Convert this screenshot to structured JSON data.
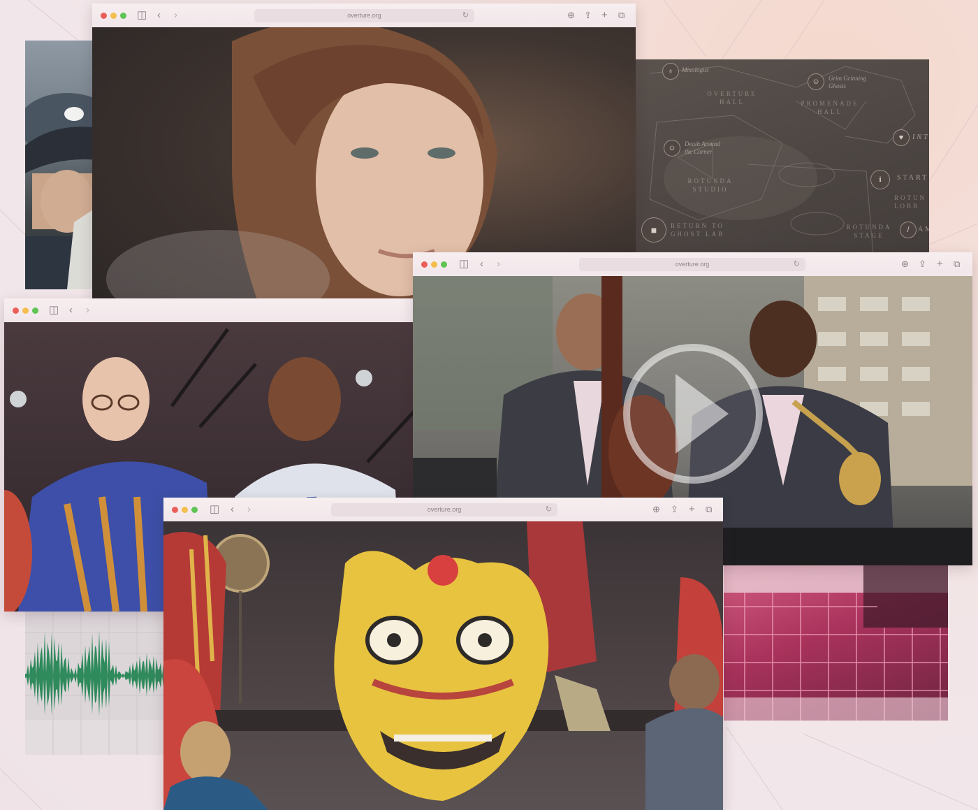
{
  "browser": {
    "url": "overture.org"
  },
  "map": {
    "labels": {
      "overture_hall": "OVERTURE\nHALL",
      "promenade_hall": "PROMENADE\nHALL",
      "rotunda_studio": "ROTUNDA\nSTUDIO",
      "rotunda_stage": "ROTUNDA\nSTAGE",
      "rotunda_lobby": "ROTUN\nLOBB",
      "return_ghost_lab": "RETURN TO\nGHOST LAB",
      "start": "START",
      "intro": "INTR",
      "am": "AM"
    },
    "pins": {
      "mixologist": "Mixologist",
      "grim_grinning_ghosts": "Grim Grinning\nGhosts",
      "death_around_corner": "Death Around\nthe Corner"
    }
  },
  "colors": {
    "waveform": "#2f8a5c",
    "pink_building": "#c8426c"
  },
  "icons": {
    "play": "play-circle-icon",
    "camera": "video-camera-icon",
    "info": "info-icon",
    "heart": "heart-icon"
  }
}
